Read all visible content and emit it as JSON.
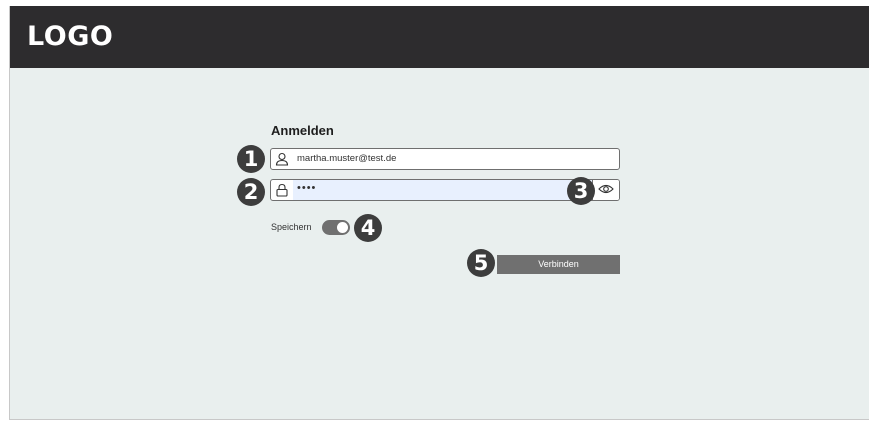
{
  "header": {
    "logo": "LOGO"
  },
  "login": {
    "title": "Anmelden",
    "email_value": "martha.muster@test.de",
    "password_value": "••••",
    "save_label": "Speichern",
    "save_enabled": true,
    "submit_label": "Verbinden"
  },
  "badges": [
    "1",
    "2",
    "3",
    "4",
    "5"
  ],
  "icons": {
    "email": "user-icon",
    "password": "lock-icon",
    "show_password": "eye-icon"
  },
  "colors": {
    "header_bg": "#2d2c2e",
    "page_bg": "#e9efee",
    "button_bg": "#707070",
    "badge_bg": "#3d3d3d",
    "autofill_bg": "#e8f0fe"
  }
}
